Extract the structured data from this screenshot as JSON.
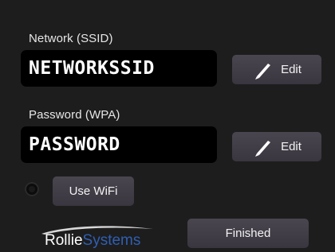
{
  "network": {
    "label": "Network (SSID)",
    "value": "NETWORKSSID",
    "edit_label": "Edit"
  },
  "password": {
    "label": "Password (WPA)",
    "value": "PASSWORD",
    "edit_label": "Edit"
  },
  "wifi": {
    "label": "Use WiFi",
    "selected": false
  },
  "finished_label": "Finished",
  "logo": {
    "part1": "Rollie",
    "part2": "Systems",
    "part1_color": "#ffffff",
    "part2_color": "#2f5fb3"
  },
  "icons": {
    "edit": "pencil-icon"
  },
  "colors": {
    "background": "#1d1d1d",
    "field_background": "#000000",
    "button_background": "#433f48",
    "text": "#e6e6e6"
  }
}
